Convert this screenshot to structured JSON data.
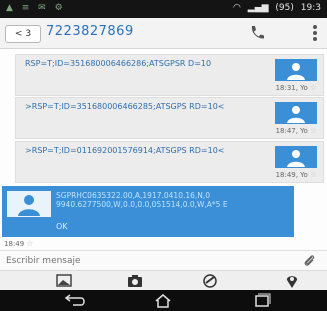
{
  "status_bar": {
    "left_icons": [
      "notification-icons"
    ],
    "right": {
      "wifi": "wifi-icon",
      "signal": "signal-icon",
      "battery": "(95)",
      "time": "19:3"
    }
  },
  "header": {
    "back_label": "<",
    "back_count": "3",
    "title": "7223827869"
  },
  "messages": [
    {
      "text": "RSP=T;ID=351680006466286;ATSGPSR D=10",
      "time": "18:31, Yo",
      "status_icon": "star-icon"
    },
    {
      "text": ">RSP=T;ID=351680006466285;ATSGPS RD=10<",
      "time": "18:47, Yo",
      "status_icon": "star-icon"
    },
    {
      "text": ">RSP=T;ID=011692001576914;ATSGPS RD=10<",
      "time": "18:49, Yo",
      "status_icon": "star-icon"
    }
  ],
  "incoming": {
    "text": "SGPRHC0635322.00,A,1917.0410.16,N,0 9940.6277500,W,0.0,0.0,051514,0.0,W,A*5 E",
    "ok": "OK",
    "time": "18:49"
  },
  "compose": {
    "placeholder": "Escribir mensaje"
  },
  "icons": {
    "call": "phone-icon",
    "menu": "overflow-menu-icon",
    "attach": "paperclip-icon",
    "toolbar": [
      "gallery-icon",
      "camera-icon",
      "drawing-icon",
      "location-icon"
    ],
    "nav": [
      "back-icon",
      "home-icon",
      "recents-icon"
    ]
  },
  "colors": {
    "accent": "#2c6fbf",
    "incoming_bg": "#3b8fd6",
    "statusbar": "#141414"
  }
}
